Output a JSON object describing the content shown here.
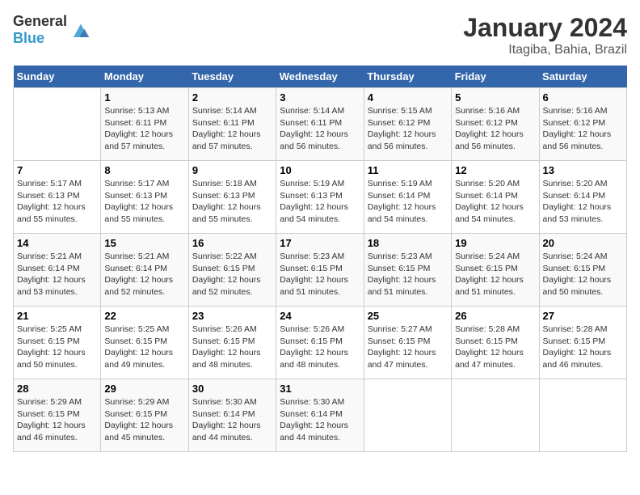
{
  "header": {
    "logo_general": "General",
    "logo_blue": "Blue",
    "month_year": "January 2024",
    "location": "Itagiba, Bahia, Brazil"
  },
  "columns": [
    "Sunday",
    "Monday",
    "Tuesday",
    "Wednesday",
    "Thursday",
    "Friday",
    "Saturday"
  ],
  "weeks": [
    [
      {
        "day": "",
        "info": ""
      },
      {
        "day": "1",
        "info": "Sunrise: 5:13 AM\nSunset: 6:11 PM\nDaylight: 12 hours\nand 57 minutes."
      },
      {
        "day": "2",
        "info": "Sunrise: 5:14 AM\nSunset: 6:11 PM\nDaylight: 12 hours\nand 57 minutes."
      },
      {
        "day": "3",
        "info": "Sunrise: 5:14 AM\nSunset: 6:11 PM\nDaylight: 12 hours\nand 56 minutes."
      },
      {
        "day": "4",
        "info": "Sunrise: 5:15 AM\nSunset: 6:12 PM\nDaylight: 12 hours\nand 56 minutes."
      },
      {
        "day": "5",
        "info": "Sunrise: 5:16 AM\nSunset: 6:12 PM\nDaylight: 12 hours\nand 56 minutes."
      },
      {
        "day": "6",
        "info": "Sunrise: 5:16 AM\nSunset: 6:12 PM\nDaylight: 12 hours\nand 56 minutes."
      }
    ],
    [
      {
        "day": "7",
        "info": "Sunrise: 5:17 AM\nSunset: 6:13 PM\nDaylight: 12 hours\nand 55 minutes."
      },
      {
        "day": "8",
        "info": "Sunrise: 5:17 AM\nSunset: 6:13 PM\nDaylight: 12 hours\nand 55 minutes."
      },
      {
        "day": "9",
        "info": "Sunrise: 5:18 AM\nSunset: 6:13 PM\nDaylight: 12 hours\nand 55 minutes."
      },
      {
        "day": "10",
        "info": "Sunrise: 5:19 AM\nSunset: 6:13 PM\nDaylight: 12 hours\nand 54 minutes."
      },
      {
        "day": "11",
        "info": "Sunrise: 5:19 AM\nSunset: 6:14 PM\nDaylight: 12 hours\nand 54 minutes."
      },
      {
        "day": "12",
        "info": "Sunrise: 5:20 AM\nSunset: 6:14 PM\nDaylight: 12 hours\nand 54 minutes."
      },
      {
        "day": "13",
        "info": "Sunrise: 5:20 AM\nSunset: 6:14 PM\nDaylight: 12 hours\nand 53 minutes."
      }
    ],
    [
      {
        "day": "14",
        "info": "Sunrise: 5:21 AM\nSunset: 6:14 PM\nDaylight: 12 hours\nand 53 minutes."
      },
      {
        "day": "15",
        "info": "Sunrise: 5:21 AM\nSunset: 6:14 PM\nDaylight: 12 hours\nand 52 minutes."
      },
      {
        "day": "16",
        "info": "Sunrise: 5:22 AM\nSunset: 6:15 PM\nDaylight: 12 hours\nand 52 minutes."
      },
      {
        "day": "17",
        "info": "Sunrise: 5:23 AM\nSunset: 6:15 PM\nDaylight: 12 hours\nand 51 minutes."
      },
      {
        "day": "18",
        "info": "Sunrise: 5:23 AM\nSunset: 6:15 PM\nDaylight: 12 hours\nand 51 minutes."
      },
      {
        "day": "19",
        "info": "Sunrise: 5:24 AM\nSunset: 6:15 PM\nDaylight: 12 hours\nand 51 minutes."
      },
      {
        "day": "20",
        "info": "Sunrise: 5:24 AM\nSunset: 6:15 PM\nDaylight: 12 hours\nand 50 minutes."
      }
    ],
    [
      {
        "day": "21",
        "info": "Sunrise: 5:25 AM\nSunset: 6:15 PM\nDaylight: 12 hours\nand 50 minutes."
      },
      {
        "day": "22",
        "info": "Sunrise: 5:25 AM\nSunset: 6:15 PM\nDaylight: 12 hours\nand 49 minutes."
      },
      {
        "day": "23",
        "info": "Sunrise: 5:26 AM\nSunset: 6:15 PM\nDaylight: 12 hours\nand 48 minutes."
      },
      {
        "day": "24",
        "info": "Sunrise: 5:26 AM\nSunset: 6:15 PM\nDaylight: 12 hours\nand 48 minutes."
      },
      {
        "day": "25",
        "info": "Sunrise: 5:27 AM\nSunset: 6:15 PM\nDaylight: 12 hours\nand 47 minutes."
      },
      {
        "day": "26",
        "info": "Sunrise: 5:28 AM\nSunset: 6:15 PM\nDaylight: 12 hours\nand 47 minutes."
      },
      {
        "day": "27",
        "info": "Sunrise: 5:28 AM\nSunset: 6:15 PM\nDaylight: 12 hours\nand 46 minutes."
      }
    ],
    [
      {
        "day": "28",
        "info": "Sunrise: 5:29 AM\nSunset: 6:15 PM\nDaylight: 12 hours\nand 46 minutes."
      },
      {
        "day": "29",
        "info": "Sunrise: 5:29 AM\nSunset: 6:15 PM\nDaylight: 12 hours\nand 45 minutes."
      },
      {
        "day": "30",
        "info": "Sunrise: 5:30 AM\nSunset: 6:14 PM\nDaylight: 12 hours\nand 44 minutes."
      },
      {
        "day": "31",
        "info": "Sunrise: 5:30 AM\nSunset: 6:14 PM\nDaylight: 12 hours\nand 44 minutes."
      },
      {
        "day": "",
        "info": ""
      },
      {
        "day": "",
        "info": ""
      },
      {
        "day": "",
        "info": ""
      }
    ]
  ]
}
